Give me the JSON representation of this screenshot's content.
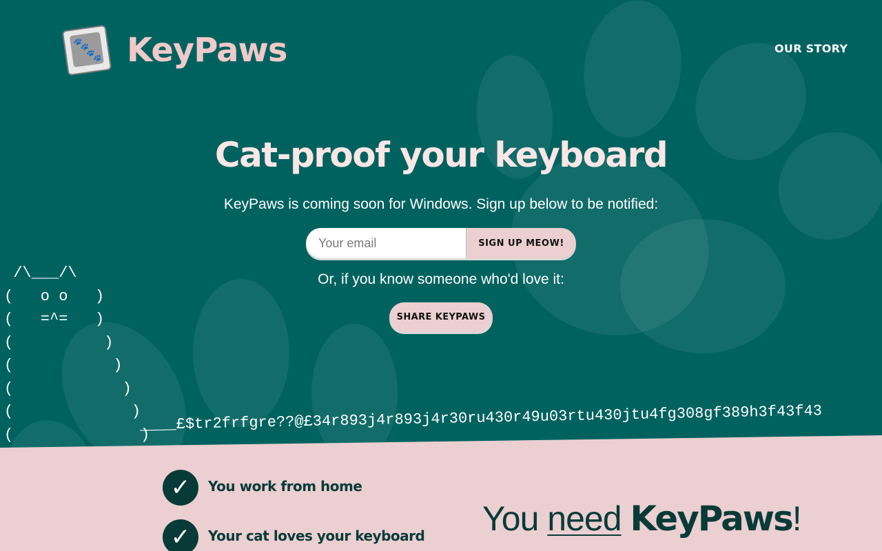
{
  "brand": {
    "name": "KeyPaws",
    "logo_icon": "paw-keycap-icon",
    "colors": {
      "teal": "#00625f",
      "pink": "#ebcfd1",
      "logo_text": "#f0c9c9",
      "dark": "#083b38"
    }
  },
  "nav": {
    "our_story": "OUR STORY"
  },
  "hero": {
    "headline": "Cat-proof your keyboard",
    "subline": "KeyPaws is coming soon for Windows. Sign up below to be notified:",
    "email_placeholder": "Your email",
    "signup_label": "SIGN UP MEOW!",
    "or_line": "Or, if you know someone who'd love it:",
    "share_label": "SHARE KEYPAWS"
  },
  "ascii_cat": " /\\___/\\\n(   o o   )\n(   =^=   )\n(          )\n(           )\n(            )\n(             )\n(              )",
  "garble": "____£$tr2frfgre??@£34r893j4r893j4r30ru430r49u03rtu430jtu4fg308gf389h3f43f43",
  "reasons": [
    "You work from home",
    "Your cat loves your keyboard"
  ],
  "tagline": {
    "prefix": "You ",
    "underlined": "need",
    "brand": "KeyPaws",
    "suffix": "!"
  }
}
